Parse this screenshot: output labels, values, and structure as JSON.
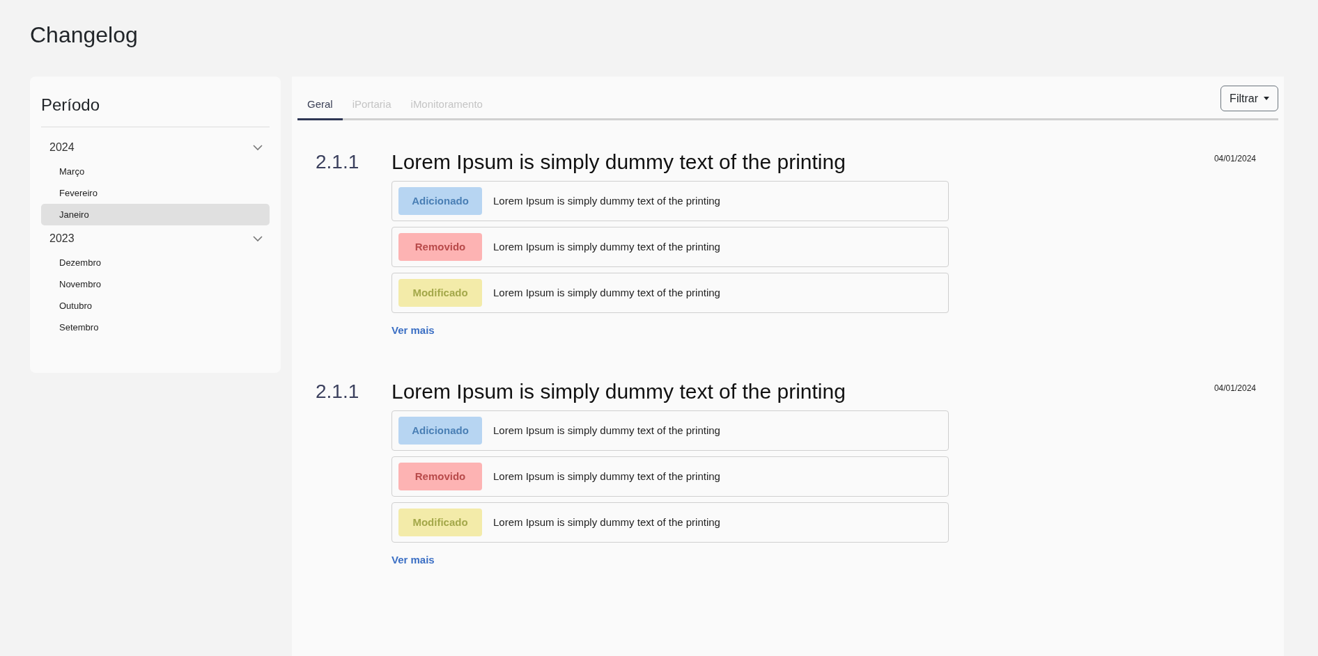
{
  "page_title": "Changelog",
  "sidebar": {
    "title": "Período",
    "groups": [
      {
        "year": "2024",
        "expanded": true,
        "months": [
          {
            "label": "Março",
            "selected": false
          },
          {
            "label": "Fevereiro",
            "selected": false
          },
          {
            "label": "Janeiro",
            "selected": true
          }
        ]
      },
      {
        "year": "2023",
        "expanded": true,
        "months": [
          {
            "label": "Dezembro",
            "selected": false
          },
          {
            "label": "Novembro",
            "selected": false
          },
          {
            "label": "Outubro",
            "selected": false
          },
          {
            "label": "Setembro",
            "selected": false
          }
        ]
      }
    ]
  },
  "tabs": [
    {
      "label": "Geral",
      "selected": true
    },
    {
      "label": "iPortaria",
      "selected": false
    },
    {
      "label": "iMonitoramento",
      "selected": false
    }
  ],
  "filter_button": "Filtrar",
  "releases": [
    {
      "version": "2.1.1",
      "title": "Lorem Ipsum is simply dummy text of the printing",
      "date": "04/01/2024",
      "changes": [
        {
          "kind": "added",
          "badge": "Adicionado",
          "text": "Lorem Ipsum is simply dummy text of the printing"
        },
        {
          "kind": "removed",
          "badge": "Removido",
          "text": "Lorem Ipsum is simply dummy text of the printing"
        },
        {
          "kind": "modified",
          "badge": "Modificado",
          "text": "Lorem Ipsum is simply dummy text of the printing"
        }
      ],
      "more_link": "Ver mais"
    },
    {
      "version": "2.1.1",
      "title": "Lorem Ipsum is simply dummy text of the printing",
      "date": "04/01/2024",
      "changes": [
        {
          "kind": "added",
          "badge": "Adicionado",
          "text": "Lorem Ipsum is simply dummy text of the printing"
        },
        {
          "kind": "removed",
          "badge": "Removido",
          "text": "Lorem Ipsum is simply dummy text of the printing"
        },
        {
          "kind": "modified",
          "badge": "Modificado",
          "text": "Lorem Ipsum is simply dummy text of the printing"
        }
      ],
      "more_link": "Ver mais"
    }
  ]
}
